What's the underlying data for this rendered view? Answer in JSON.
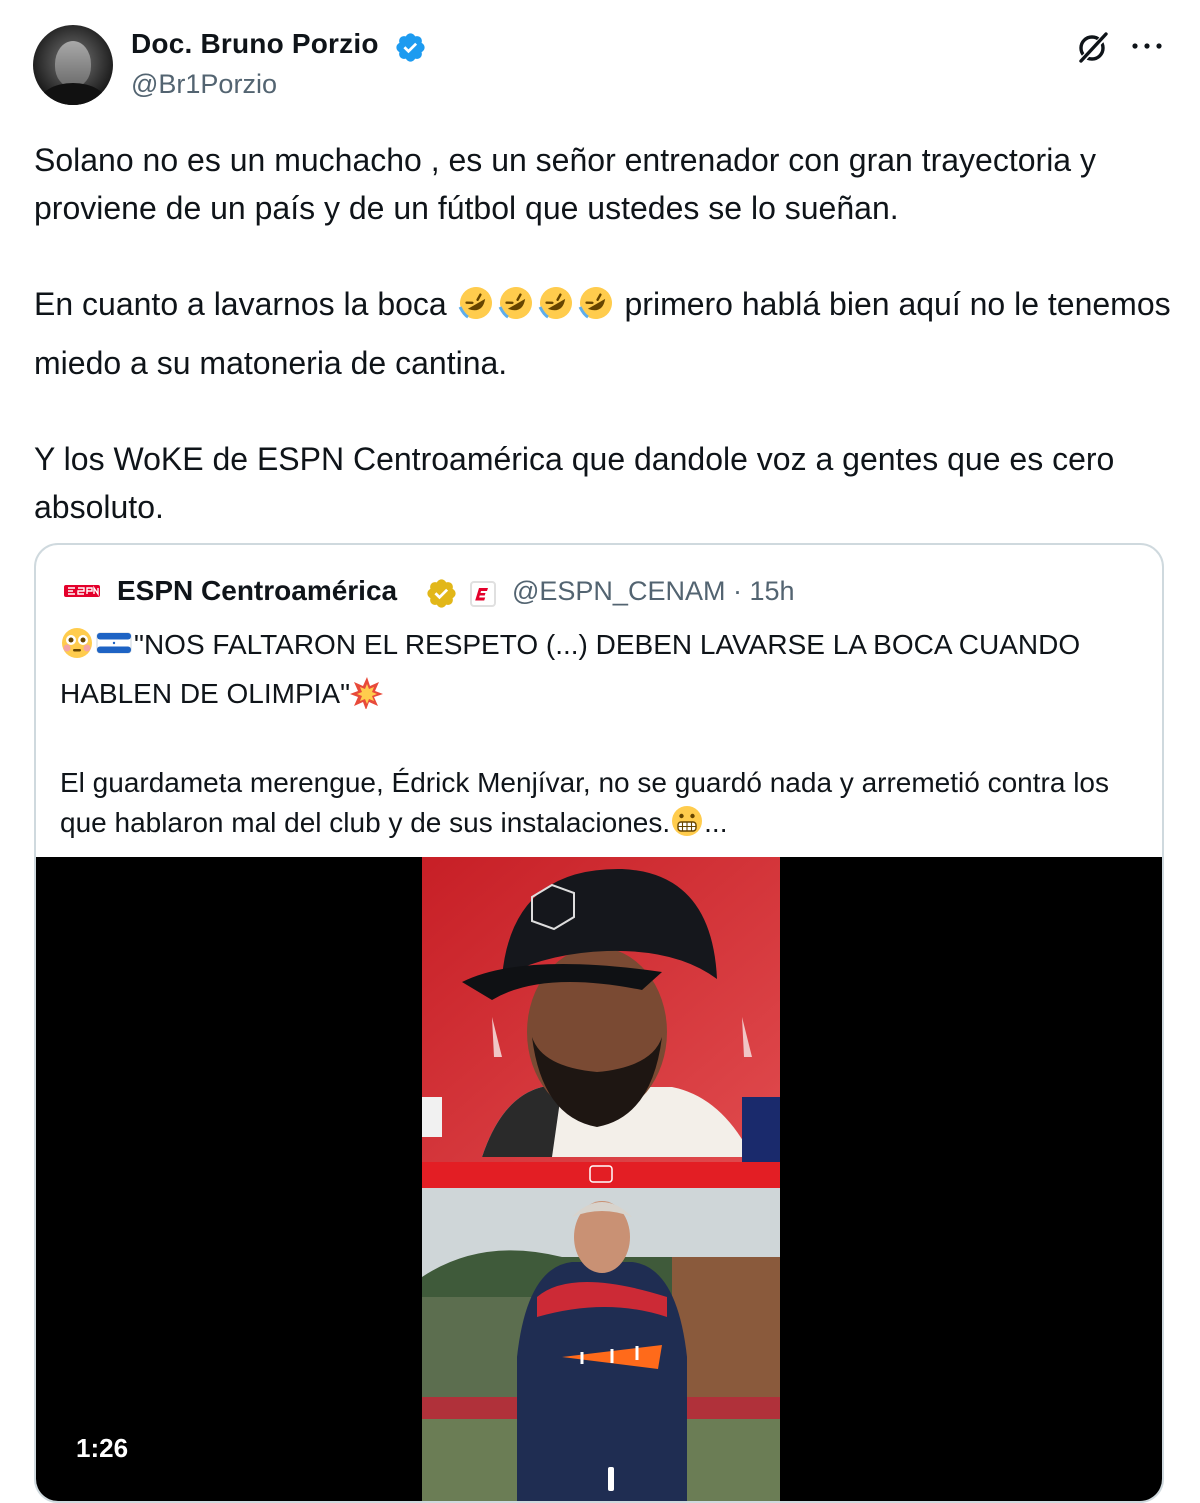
{
  "tweet": {
    "author": {
      "name": "Doc. Bruno Porzio",
      "handle": "@Br1Porzio",
      "verified": true,
      "avatar_icon": "avatar-photo"
    },
    "icons": {
      "grok": "grok-icon",
      "more": "more-options-icon"
    },
    "paragraphs": {
      "p1": "Solano no es un muchacho , es un señor entrenador con gran trayectoria y proviene de un país y de un fútbol que ustedes se lo sueñan.",
      "p2_before": "En cuanto a lavarnos la boca ",
      "p2_emoji": "🤣🤣🤣🤣",
      "p2_after": " primero hablá bien aquí no le tenemos miedo a su matoneria de cantina.",
      "p3": "Y los WoKE de ESPN Centroamérica que dandole voz a gentes que es cero absoluto."
    }
  },
  "quote": {
    "name": "ESPN Centroamérica",
    "handle_time": "@ESPN_CENAM · 15h",
    "badge": "gold-verified-badge",
    "headline_prefix_emoji": "😳🇭🇳",
    "headline": "\"NOS FALTARON EL RESPETO (...) DEBEN LAVARSE LA BOCA CUANDO HABLEN DE OLIMPIA\"",
    "headline_suffix_emoji": "💥",
    "body": "El guardameta merengue, Édrick Menjívar, no se guardó nada y arremetió contra los que hablaron mal del club y de sus instalaciones.",
    "body_suffix": "😬...",
    "video": {
      "duration": "1:26"
    }
  },
  "colors": {
    "verified_blue": "#1d9bf0",
    "gold_badge": "#e2b719",
    "espn_red": "#e4002b",
    "muted_text": "#536471"
  }
}
